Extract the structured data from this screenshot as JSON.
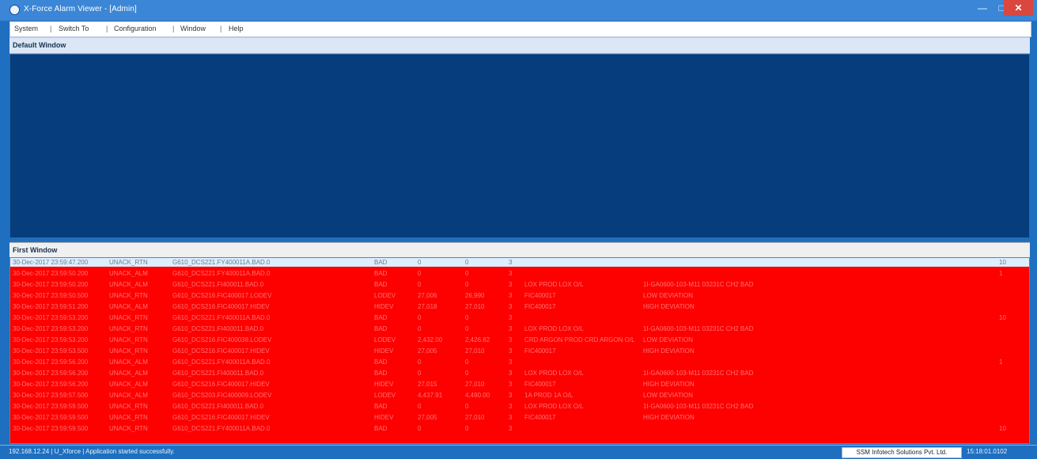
{
  "app": {
    "title": "X-Force Alarm Viewer - [Admin]",
    "window_buttons": {
      "minimize": "—",
      "maximize": "□",
      "close": "✕"
    }
  },
  "menu": [
    {
      "label": "System"
    },
    {
      "label": "Switch To"
    },
    {
      "label": "Configuration"
    },
    {
      "label": "Window"
    },
    {
      "label": "Help"
    }
  ],
  "menu_separator": "|",
  "panes": {
    "default_window": "Default Window",
    "first_window": "First Window"
  },
  "alarms": [
    {
      "time": "30-Dec-2017 23:59:47.200",
      "state": "UNACK_RTN",
      "tag": "G610_DCS221.FY400011A.BAD.0",
      "type": "BAD",
      "value": "0",
      "limit": "0",
      "priority": "3",
      "desc": "",
      "note": "",
      "count": "10"
    },
    {
      "time": "30-Dec-2017 23:59:50.200",
      "state": "UNACK_ALM",
      "tag": "G610_DCS221.FY400011A.BAD.0",
      "type": "BAD",
      "value": "0",
      "limit": "0",
      "priority": "3",
      "desc": "",
      "note": "",
      "count": "1"
    },
    {
      "time": "30-Dec-2017 23:59:50.200",
      "state": "UNACK_ALM",
      "tag": "G610_DCS221.FI400011.BAD.0",
      "type": "BAD",
      "value": "0",
      "limit": "0",
      "priority": "3",
      "desc": "LOX PROD LOX O/L",
      "note": "1I-GA0600-103-M11 03231C CH2 BAD",
      "count": ""
    },
    {
      "time": "30-Dec-2017 23:59:50.500",
      "state": "UNACK_RTN",
      "tag": "G610_DCS216.FIC400017.LODEV",
      "type": "LODEV",
      "value": "27,006",
      "limit": "26,990",
      "priority": "3",
      "desc": "FIC400017",
      "note": "LOW DEVIATION",
      "count": ""
    },
    {
      "time": "30-Dec-2017 23:59:51.200",
      "state": "UNACK_ALM",
      "tag": "G610_DCS216.FIC400017.HIDEV",
      "type": "HIDEV",
      "value": "27,018",
      "limit": "27,010",
      "priority": "3",
      "desc": "FIC400017",
      "note": "HIGH DEVIATION",
      "count": ""
    },
    {
      "time": "30-Dec-2017 23:59:53.200",
      "state": "UNACK_RTN",
      "tag": "G610_DCS221.FY400011A.BAD.0",
      "type": "BAD",
      "value": "0",
      "limit": "0",
      "priority": "3",
      "desc": "",
      "note": "",
      "count": "10"
    },
    {
      "time": "30-Dec-2017 23:59:53.200",
      "state": "UNACK_RTN",
      "tag": "G610_DCS221.FI400011.BAD.0",
      "type": "BAD",
      "value": "0",
      "limit": "0",
      "priority": "3",
      "desc": "LOX PROD LOX O/L",
      "note": "1I-GA0600-103-M11 03231C CH2 BAD",
      "count": ""
    },
    {
      "time": "30-Dec-2017 23:59:53.200",
      "state": "UNACK_RTN",
      "tag": "G610_DCS216.FIC400038.LODEV",
      "type": "LODEV",
      "value": "2,432.00",
      "limit": "2,426.82",
      "priority": "3",
      "desc": "CRD ARGON PROD CRD ARGON O/L",
      "note": "LOW DEVIATION",
      "count": ""
    },
    {
      "time": "30-Dec-2017 23:59:53.500",
      "state": "UNACK_RTN",
      "tag": "G610_DCS216.FIC400017.HIDEV",
      "type": "HIDEV",
      "value": "27,005",
      "limit": "27,010",
      "priority": "3",
      "desc": "FIC400017",
      "note": "HIGH DEVIATION",
      "count": ""
    },
    {
      "time": "30-Dec-2017 23:59:56.200",
      "state": "UNACK_ALM",
      "tag": "G610_DCS221.FY400011A.BAD.0",
      "type": "BAD",
      "value": "0",
      "limit": "0",
      "priority": "3",
      "desc": "",
      "note": "",
      "count": "1"
    },
    {
      "time": "30-Dec-2017 23:59:56.200",
      "state": "UNACK_ALM",
      "tag": "G610_DCS221.FI400011.BAD.0",
      "type": "BAD",
      "value": "0",
      "limit": "0",
      "priority": "3",
      "desc": "LOX PROD LOX O/L",
      "note": "1I-GA0600-103-M11 03231C CH2 BAD",
      "count": ""
    },
    {
      "time": "30-Dec-2017 23:59:56.200",
      "state": "UNACK_ALM",
      "tag": "G610_DCS216.FIC400017.HIDEV",
      "type": "HIDEV",
      "value": "27,015",
      "limit": "27,010",
      "priority": "3",
      "desc": "FIC400017",
      "note": "HIGH DEVIATION",
      "count": ""
    },
    {
      "time": "30-Dec-2017 23:59:57.500",
      "state": "UNACK_ALM",
      "tag": "G610_DCS203.FIC400009.LODEV",
      "type": "LODEV",
      "value": "4,437.91",
      "limit": "4,490.00",
      "priority": "3",
      "desc": "1A PROD 1A O/L",
      "note": "LOW DEVIATION",
      "count": ""
    },
    {
      "time": "30-Dec-2017 23:59:59.500",
      "state": "UNACK_RTN",
      "tag": "G610_DCS221.FI400011.BAD.0",
      "type": "BAD",
      "value": "0",
      "limit": "0",
      "priority": "3",
      "desc": "LOX PROD LOX O/L",
      "note": "1I-GA0600-103-M11 03231C CH2 BAD",
      "count": ""
    },
    {
      "time": "30-Dec-2017 23:59:59.500",
      "state": "UNACK_RTN",
      "tag": "G610_DCS216.FIC400017.HIDEV",
      "type": "HIDEV",
      "value": "27,005",
      "limit": "27,010",
      "priority": "3",
      "desc": "FIC400017",
      "note": "HIGH DEVIATION",
      "count": ""
    },
    {
      "time": "30-Dec-2017 23:59:59.500",
      "state": "UNACK_RTN",
      "tag": "G610_DCS221.FY400011A.BAD.0",
      "type": "BAD",
      "value": "0",
      "limit": "0",
      "priority": "3",
      "desc": "",
      "note": "",
      "count": "10"
    }
  ],
  "status": {
    "left": "192.168.12.24  |  U_Xforce  |  Application started successfully.",
    "company": "SSM Infotech Solutions Pvt. Ltd.",
    "clock": "15:18:01.0102"
  },
  "colors": {
    "alarm_background": "#ff0000",
    "default_pane_background": "#063d7c",
    "selected_row_background": "#dcefff"
  }
}
